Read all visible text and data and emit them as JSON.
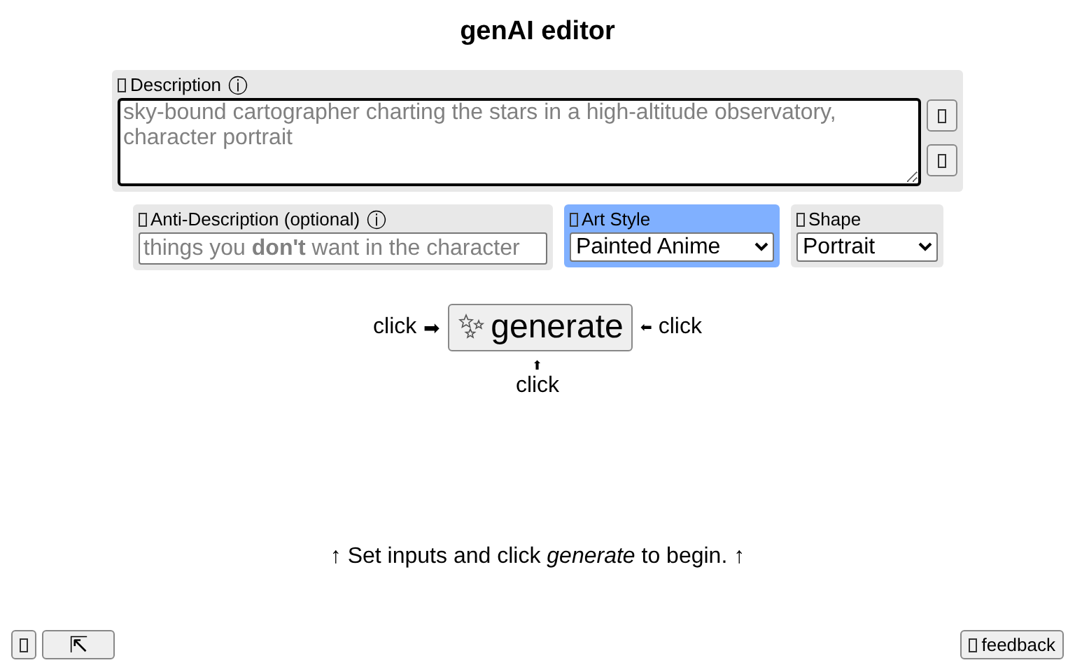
{
  "title": "genAI editor",
  "description": {
    "label": "Description",
    "info": "ⓘ",
    "placeholder": "sky-bound cartographer charting the stars in a high-altitude observatory, character portrait"
  },
  "anti_description": {
    "label": "Anti-Description (optional)",
    "info": "ⓘ",
    "placeholder": "things you **don't** want in the character"
  },
  "art_style": {
    "label": "Art Style",
    "value": "Painted Anime",
    "highlighted": true
  },
  "shape": {
    "label": "Shape",
    "value": "Portrait",
    "highlighted": false
  },
  "generate": {
    "label": "generate",
    "left_hint": "click",
    "left_arrow": "➡",
    "right_arrow": "⬅",
    "right_hint": "click",
    "bottom_arrow": "⬆",
    "bottom_hint": "click"
  },
  "status": "↑ Set inputs and click *generate* to begin. ↑",
  "footer": {
    "back_button": "⇱",
    "feedback_button": "feedback"
  }
}
